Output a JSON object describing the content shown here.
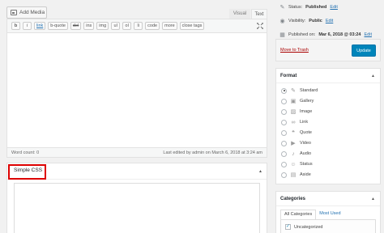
{
  "editor": {
    "add_media_label": "Add Media",
    "mode_visual": "Visual",
    "mode_text": "Text",
    "quicktags": [
      "b",
      "i",
      "link",
      "b-quote",
      "del",
      "ins",
      "img",
      "ul",
      "ol",
      "li",
      "code",
      "more",
      "close tags"
    ],
    "word_count": "Word count: 0",
    "last_edited": "Last edited by admin on March 6, 2018 at 3:24 am"
  },
  "simple_css": {
    "title": "Simple CSS"
  },
  "publish": {
    "status_label": "Status:",
    "status_value": "Published",
    "visibility_label": "Visibility:",
    "visibility_value": "Public",
    "published_label": "Published on:",
    "published_value": "Mar 6, 2018 @ 03:24",
    "edit_label": "Edit",
    "move_to_trash": "Move to Trash",
    "update_button": "Update",
    "accent_color": "#0085ba"
  },
  "format": {
    "title": "Format",
    "selected": "Standard",
    "options": [
      {
        "label": "Standard",
        "icon": "pin-icon"
      },
      {
        "label": "Gallery",
        "icon": "gallery-icon"
      },
      {
        "label": "Image",
        "icon": "image-icon"
      },
      {
        "label": "Link",
        "icon": "link-icon"
      },
      {
        "label": "Quote",
        "icon": "quote-icon"
      },
      {
        "label": "Video",
        "icon": "video-icon"
      },
      {
        "label": "Audio",
        "icon": "audio-icon"
      },
      {
        "label": "Status",
        "icon": "status-icon"
      },
      {
        "label": "Aside",
        "icon": "aside-icon"
      }
    ]
  },
  "categories": {
    "title": "Categories",
    "tab_all": "All Categories",
    "tab_most_used": "Most Used",
    "items": [
      {
        "label": "Uncategorized",
        "checked": true
      }
    ]
  }
}
